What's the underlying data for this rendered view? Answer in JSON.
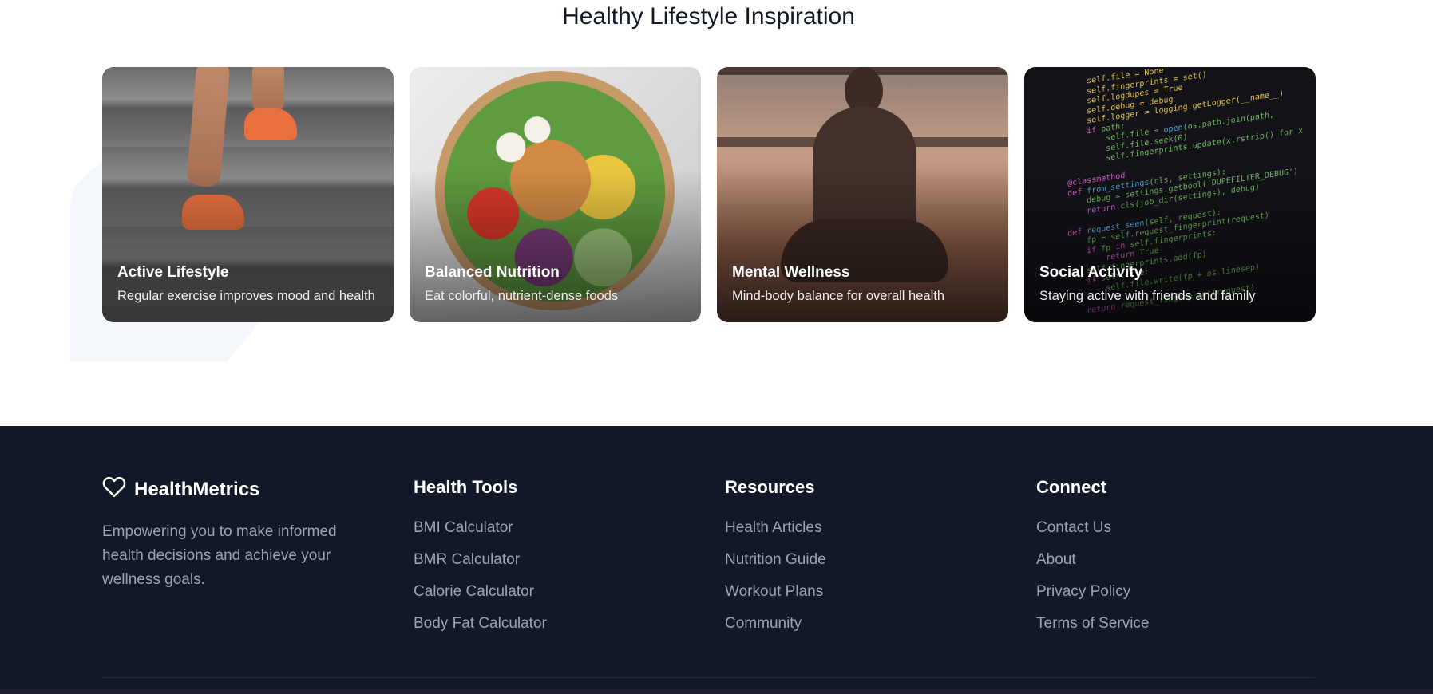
{
  "inspiration": {
    "title": "Healthy Lifestyle Inspiration",
    "cards": [
      {
        "title": "Active Lifestyle",
        "description": "Regular exercise improves mood and health"
      },
      {
        "title": "Balanced Nutrition",
        "description": "Eat colorful, nutrient-dense foods"
      },
      {
        "title": "Mental Wellness",
        "description": "Mind-body balance for overall health"
      },
      {
        "title": "Social Activity",
        "description": "Staying active with friends and family"
      }
    ]
  },
  "footer": {
    "brand": {
      "name": "HealthMetrics",
      "icon": "heart-icon"
    },
    "tagline": "Empowering you to make informed health decisions and achieve your wellness goals.",
    "columns": [
      {
        "heading": "Health Tools",
        "links": [
          "BMI Calculator",
          "BMR Calculator",
          "Calorie Calculator",
          "Body Fat Calculator"
        ]
      },
      {
        "heading": "Resources",
        "links": [
          "Health Articles",
          "Nutrition Guide",
          "Workout Plans",
          "Community"
        ]
      },
      {
        "heading": "Connect",
        "links": [
          "Contact Us",
          "About",
          "Privacy Policy",
          "Terms of Service"
        ]
      }
    ]
  },
  "colors": {
    "footer_bg": "#111827",
    "footer_text": "#9ca3af",
    "heading": "#111827"
  }
}
